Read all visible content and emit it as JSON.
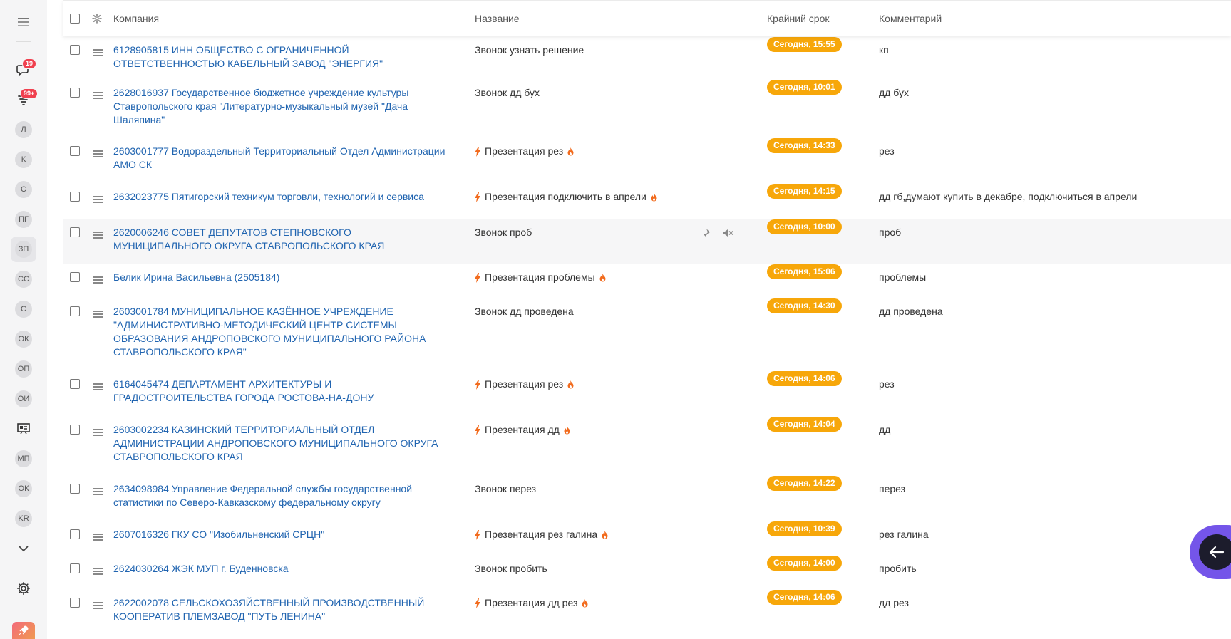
{
  "sidebar": {
    "chat_badge": "19",
    "feed_badge": "99+",
    "users": [
      "л",
      "к",
      "с",
      "пг",
      "зп",
      "сс",
      "с",
      "ок",
      "оп",
      "ои",
      "",
      "мп",
      "ок",
      "kr"
    ],
    "active_user_index": 4
  },
  "header": {
    "company": "Компания",
    "title": "Название",
    "deadline": "Крайний срок",
    "comment": "Комментарий"
  },
  "rows": [
    {
      "company": "6128905815 ИНН ОБЩЕСТВО С ОГРАНИЧЕННОЙ ОТВЕТСТВЕННОСТЬЮ КАБЕЛЬНЫЙ ЗАВОД \"ЭНЕРГИЯ\"",
      "title": "Звонок узнать решение",
      "urgent": false,
      "deadline": "Сегодня, 15:55",
      "comment": "кп"
    },
    {
      "company": "2628016937 Государственное бюджетное учреждение культуры Ставропольского края \"Литературно-музыкальный музей \"Дача Шаляпина\"",
      "title": "Звонок дд бух",
      "urgent": false,
      "deadline": "Сегодня, 10:01",
      "comment": "дд бух"
    },
    {
      "company": "2603001777 Водораздельный Территориальный Отдел Администрации АМО СК",
      "title": "Презентация рез",
      "urgent": true,
      "deadline": "Сегодня, 14:33",
      "comment": "рез"
    },
    {
      "company": "2632023775 Пятигорский техникум торговли, технологий и сервиса",
      "title": "Презентация подключить в апрели",
      "urgent": true,
      "deadline": "Сегодня, 14:15",
      "comment": "дд гб,думают купить в декабре, подключиться в апрели"
    },
    {
      "company": "2620006246 СОВЕТ ДЕПУТАТОВ СТЕПНОВСКОГО МУНИЦИПАЛЬНОГО ОКРУГА СТАВРОПОЛЬСКОГО КРАЯ",
      "title": "Звонок проб",
      "urgent": false,
      "deadline": "Сегодня, 10:00",
      "comment": "проб"
    },
    {
      "company": "Белик Ирина Васильевна (2505184)",
      "title": "Презентация проблемы",
      "urgent": true,
      "deadline": "Сегодня, 15:06",
      "comment": "проблемы"
    },
    {
      "company": "2603001784 МУНИЦИПАЛЬНОЕ КАЗЁННОЕ УЧРЕЖДЕНИЕ \"АДМИНИСТРАТИВНО-МЕТОДИЧЕСКИЙ ЦЕНТР СИСТЕМЫ ОБРАЗОВАНИЯ АНДРОПОВСКОГО МУНИЦИПАЛЬНОГО РАЙОНА СТАВРОПОЛЬСКОГО КРАЯ\"",
      "title": "Звонок дд проведена",
      "urgent": false,
      "deadline": "Сегодня, 14:30",
      "comment": "дд проведена"
    },
    {
      "company": "6164045474 ДЕПАРТАМЕНТ АРХИТЕКТУРЫ И ГРАДОСТРОИТЕЛЬСТВА ГОРОДА РОСТОВА-НА-ДОНУ",
      "title": "Презентация рез",
      "urgent": true,
      "deadline": "Сегодня, 14:06",
      "comment": "рез"
    },
    {
      "company": "2603002234 КАЗИНСКИЙ ТЕРРИТОРИАЛЬНЫЙ ОТДЕЛ АДМИНИСТРАЦИИ АНДРОПОВСКОГО МУНИЦИПАЛЬНОГО ОКРУГА СТАВРОПОЛЬСКОГО КРАЯ",
      "title": "Презентация дд",
      "urgent": true,
      "deadline": "Сегодня, 14:04",
      "comment": "дд"
    },
    {
      "company": "2634098984 Управление Федеральной службы государственной статистики по Северо-Кавказскому федеральному округу",
      "title": "Звонок перез",
      "urgent": false,
      "deadline": "Сегодня, 14:22",
      "comment": "перез"
    },
    {
      "company": "2607016326 ГКУ СО \"Изобильненский СРЦН\"",
      "title": "Презентация рез галина",
      "urgent": true,
      "deadline": "Сегодня, 10:39",
      "comment": "рез галина"
    },
    {
      "company": "2624030264 ЖЭК МУП г. Буденновска",
      "title": "Звонок пробить",
      "urgent": false,
      "deadline": "Сегодня, 14:00",
      "comment": "пробить"
    },
    {
      "company": "2622002078 СЕЛЬСКОХОЗЯЙСТВЕННЫЙ ПРОИЗВОДСТВЕННЫЙ КООПЕРАТИВ ПЛЕМЗАВОД \"ПУТЬ ЛЕНИНА\"",
      "title": "Презентация дд рез",
      "urgent": true,
      "deadline": "Сегодня, 14:06",
      "comment": "дд рез"
    }
  ],
  "hover_row_index": 4,
  "colors": {
    "link": "#2064b0",
    "deadline_badge": "#f7a70a",
    "urgent_icon": "#f26b1d",
    "notification_badge": "#f0404f",
    "fab": "#7455e9"
  }
}
